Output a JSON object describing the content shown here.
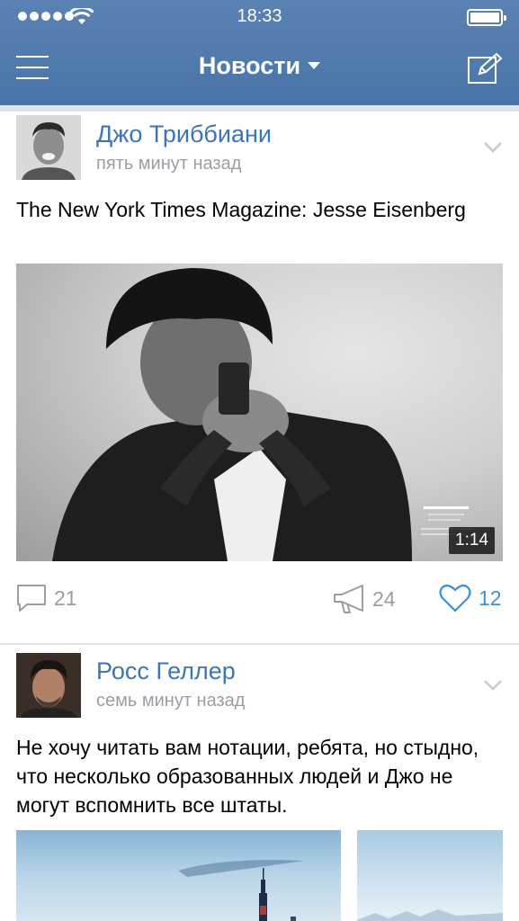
{
  "status_bar": {
    "time": "18:33"
  },
  "nav": {
    "title": "Новости"
  },
  "colors": {
    "header_bg": "#4a74a8",
    "link_blue": "#3d76b6",
    "like_blue": "#3d8fd8",
    "meta_gray": "#9a9ea4",
    "feed_bg": "#dfe3e8"
  },
  "posts": [
    {
      "author": "Джо Триббиани",
      "time_ago": "пять минут назад",
      "text": "The New York Times Magazine: Jesse Eisenberg",
      "video_duration": "1:14",
      "comments": "21",
      "shares": "24",
      "likes": "12"
    },
    {
      "author": "Росс Геллер",
      "time_ago": "семь минут назад",
      "text": "Не хочу читать вам нотации, ребята, но стыдно, что несколько образованных людей и Джо не могут вспомнить все штаты."
    }
  ],
  "icons": [
    "menu-icon",
    "compose-icon",
    "chevron-down-icon",
    "comment-icon",
    "share-megaphone-icon",
    "heart-icon",
    "wifi-icon",
    "battery-icon"
  ]
}
